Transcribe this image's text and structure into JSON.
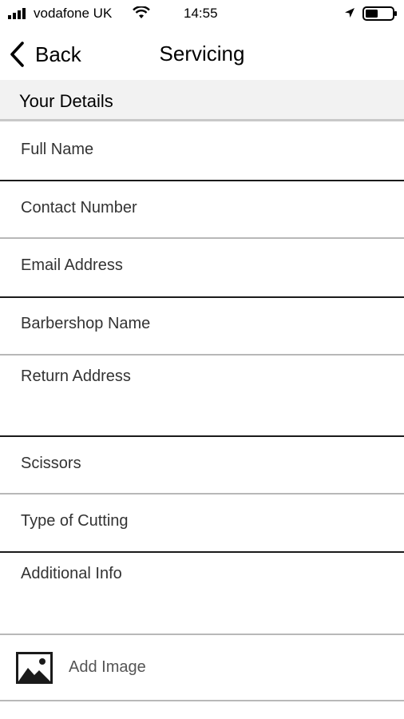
{
  "status_bar": {
    "carrier": "vodafone UK",
    "time": "14:55",
    "icons": [
      "signal-icon",
      "wifi-icon",
      "location-arrow-icon",
      "battery-icon"
    ]
  },
  "nav": {
    "back_label": "Back",
    "title": "Servicing"
  },
  "section": {
    "title": "Your Details"
  },
  "fields": [
    {
      "placeholder": "Full Name"
    },
    {
      "placeholder": "Contact Number"
    },
    {
      "placeholder": "Email Address"
    },
    {
      "placeholder": "Barbershop Name"
    },
    {
      "placeholder": "Return Address"
    },
    {
      "placeholder": "Scissors"
    },
    {
      "placeholder": "Type of Cutting"
    },
    {
      "placeholder": "Additional Info"
    }
  ],
  "add_image": {
    "label": "Add Image",
    "icon": "image-icon"
  },
  "colors": {
    "section_bg": "#f2f2f2",
    "text": "#000000",
    "placeholder": "#333333"
  }
}
